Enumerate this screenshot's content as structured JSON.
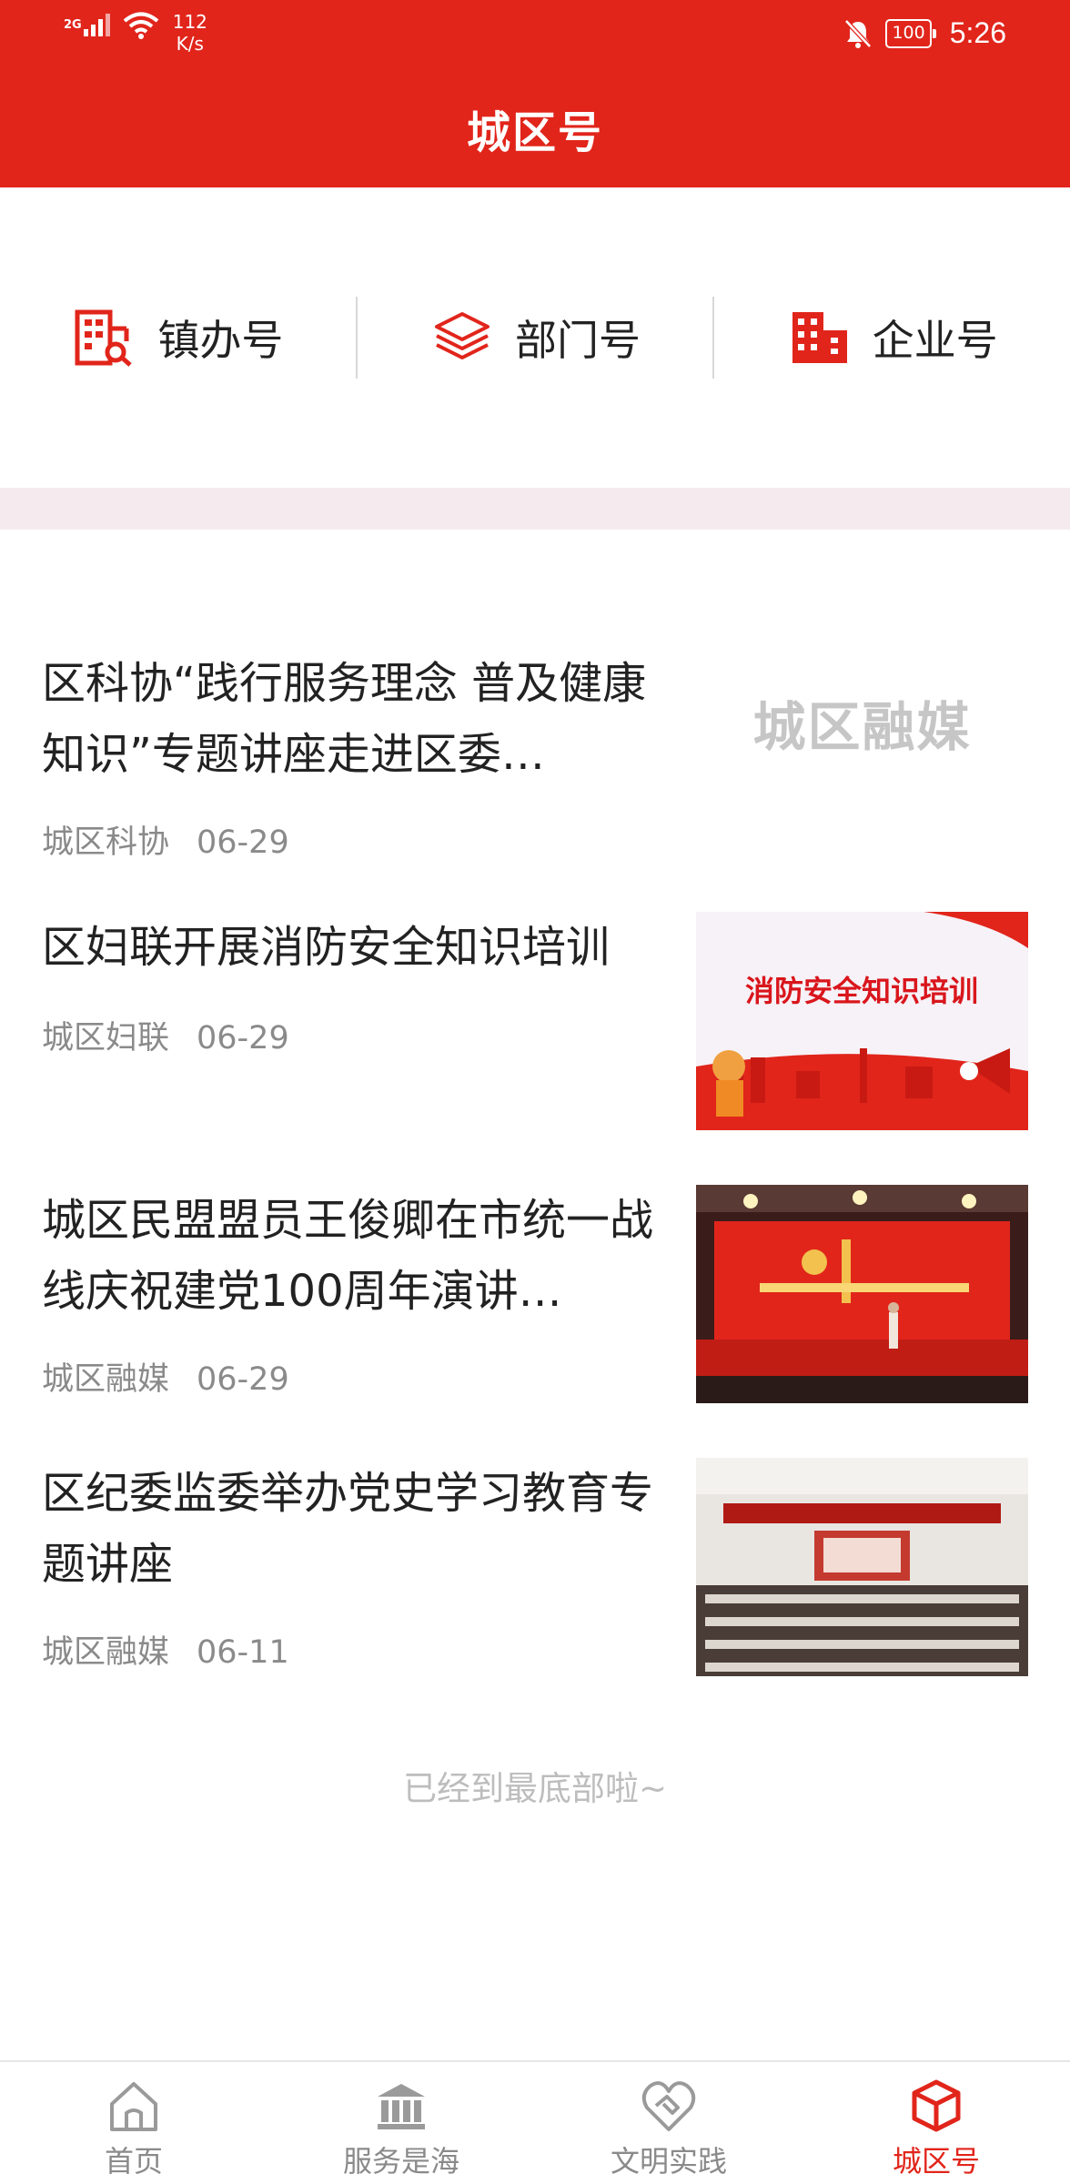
{
  "status_bar": {
    "network_type": "2G",
    "speed_value": "112",
    "speed_unit": "K/s",
    "battery": "100",
    "time": "5:26"
  },
  "header": {
    "title": "城区号"
  },
  "categories": [
    {
      "label": "镇办号",
      "icon": "town-office-icon"
    },
    {
      "label": "部门号",
      "icon": "layers-icon"
    },
    {
      "label": "企业号",
      "icon": "enterprise-building-icon"
    }
  ],
  "articles": [
    {
      "title": "区科协“践行服务理念 普及健康知识”专题讲座走进区委…",
      "source": "城区科协",
      "date": "06-29",
      "thumb_text": "城区融媒"
    },
    {
      "title": "区妇联开展消防安全知识培训",
      "source": "城区妇联",
      "date": "06-29",
      "thumb_caption": "消防安全知识培训"
    },
    {
      "title": "城区民盟盟员王俊卿在市统一战线庆祝建党100周年演讲…",
      "source": "城区融媒",
      "date": "06-29"
    },
    {
      "title": "区纪委监委举办党史学习教育专题讲座",
      "source": "城区融媒",
      "date": "06-11"
    }
  ],
  "list_end": "已经到最底部啦~",
  "tabbar": [
    {
      "label": "首页",
      "icon": "home-icon",
      "active": false
    },
    {
      "label": "服务是海",
      "icon": "bank-icon",
      "active": false
    },
    {
      "label": "文明实践",
      "icon": "handshake-heart-icon",
      "active": false
    },
    {
      "label": "城区号",
      "icon": "cube-icon",
      "active": true
    }
  ],
  "colors": {
    "brand": "#e1251b",
    "band": "#f5ebef",
    "muted": "#8a8a8a"
  }
}
